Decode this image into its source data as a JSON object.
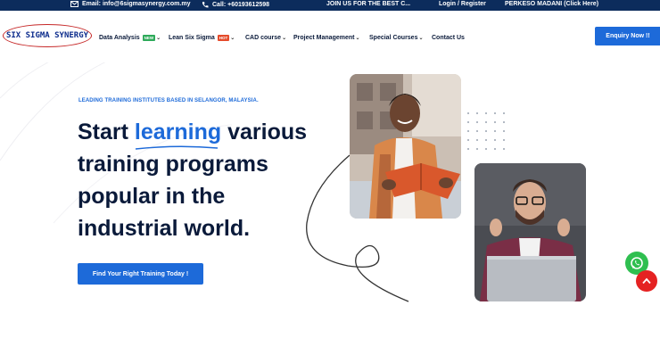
{
  "topbar": {
    "email": "Email: info@6sigmasynergy.com.my",
    "phone": "Call: +60193612598",
    "marquee": "JOIN US FOR THE BEST C...",
    "login": "Login / Register",
    "perkeso": "PERKESO MADANI (Click Here)"
  },
  "logo": {
    "text": "SIX SIGMA SYNERGY"
  },
  "nav": {
    "items": [
      {
        "label": "Data Analysis",
        "badge": "NEW",
        "badge_color": "#2eaa5a"
      },
      {
        "label": "Lean Six Sigma",
        "badge": "HOT",
        "badge_color": "#e54b2b"
      },
      {
        "label": "CAD course"
      },
      {
        "label": "Project Management"
      },
      {
        "label": "Special Courses"
      },
      {
        "label": "Contact Us"
      }
    ],
    "enquiry": "Enquiry Now !!"
  },
  "hero": {
    "kicker": "LEADING TRAINING INSTITUTES BASED IN SELANGOR, MALAYSIA.",
    "headline_start": "Start ",
    "headline_accent": "learning",
    "headline_rest": " various training programs popular in the industrial world.",
    "cta": "Find Your Right Training Today !"
  },
  "colors": {
    "topbar": "#0c2c5c",
    "accent": "#1d6ad9",
    "whatsapp": "#2fbf50",
    "scroll_top": "#e52222"
  },
  "icons": [
    "mail-icon",
    "phone-icon",
    "whatsapp-icon",
    "arrow-up-icon",
    "chevron-down-icon"
  ]
}
